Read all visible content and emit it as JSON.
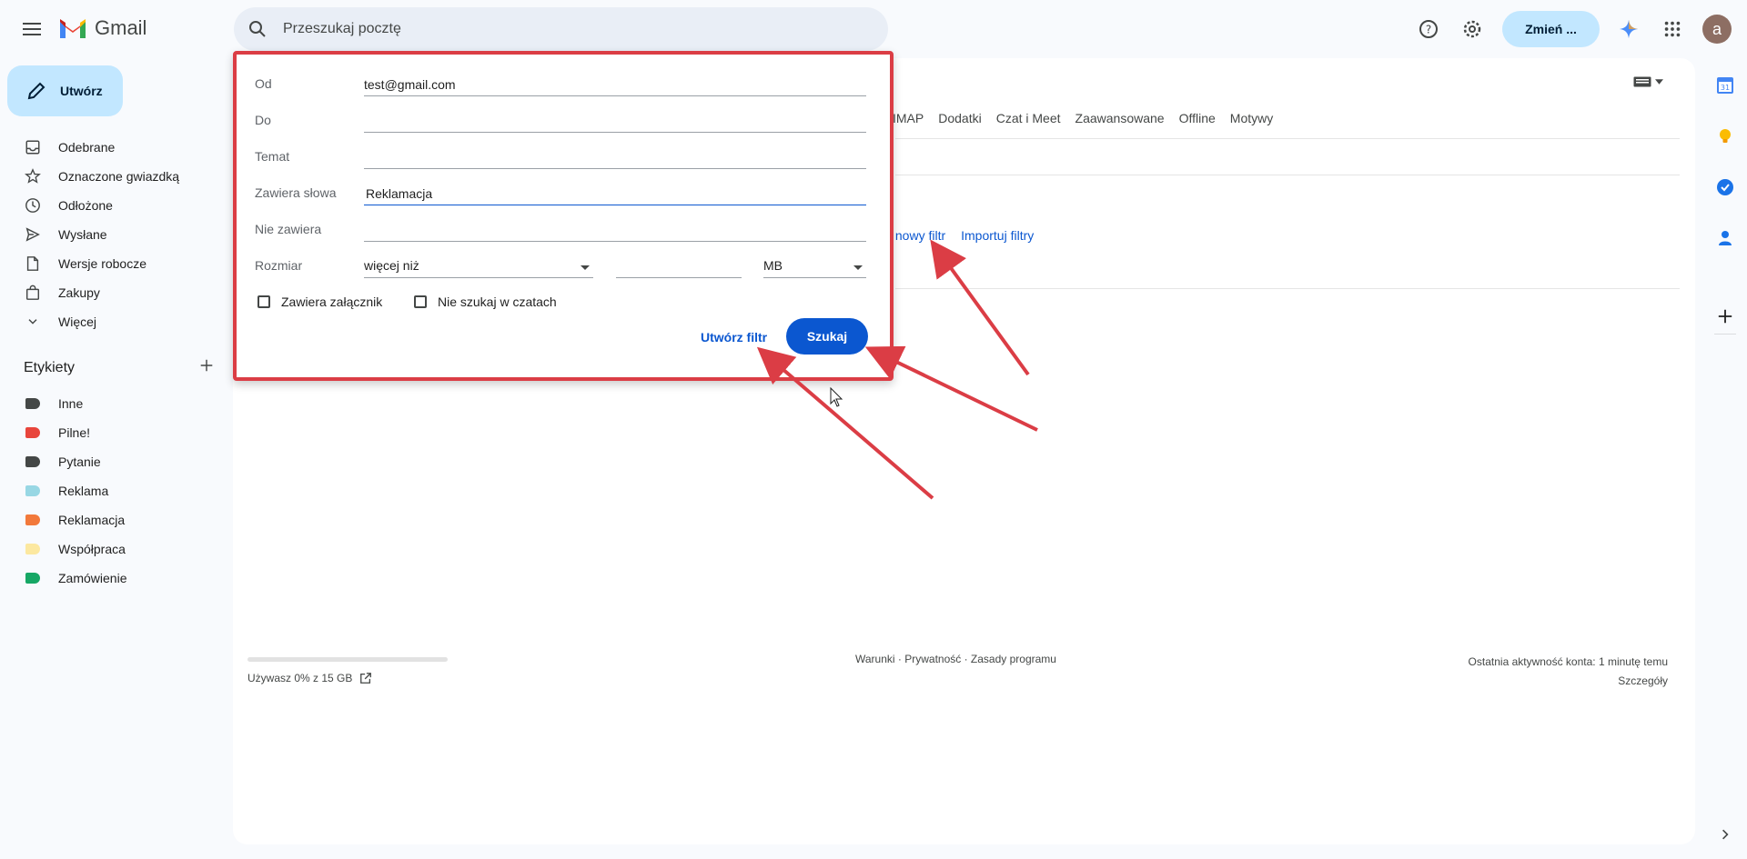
{
  "app": {
    "name": "Gmail"
  },
  "search": {
    "placeholder": "Przeszukaj pocztę"
  },
  "header": {
    "switch_button": "Zmień ...",
    "avatar_letter": "a"
  },
  "compose": {
    "label": "Utwórz"
  },
  "nav": {
    "items": [
      {
        "label": "Odebrane",
        "icon": "inbox-icon"
      },
      {
        "label": "Oznaczone gwiazdką",
        "icon": "star-icon"
      },
      {
        "label": "Odłożone",
        "icon": "clock-icon"
      },
      {
        "label": "Wysłane",
        "icon": "send-icon"
      },
      {
        "label": "Wersje robocze",
        "icon": "draft-icon"
      },
      {
        "label": "Zakupy",
        "icon": "shopping-bag-icon"
      },
      {
        "label": "Więcej",
        "icon": "chevron-down-icon"
      }
    ]
  },
  "labels": {
    "title": "Etykiety",
    "items": [
      {
        "label": "Inne",
        "color": "#444746"
      },
      {
        "label": "Pilne!",
        "color": "#e8453c"
      },
      {
        "label": "Pytanie",
        "color": "#444746"
      },
      {
        "label": "Reklama",
        "color": "#98d7e4"
      },
      {
        "label": "Reklamacja",
        "color": "#f2793b"
      },
      {
        "label": "Współpraca",
        "color": "#fce8a0"
      },
      {
        "label": "Zamówienie",
        "color": "#16a765"
      }
    ]
  },
  "settings_tabs": [
    "IMAP",
    "Dodatki",
    "Czat i Meet",
    "Zaawansowane",
    "Offline",
    "Motywy"
  ],
  "filter_links": {
    "create": "z nowy filtr",
    "import": "Importuj filtry"
  },
  "search_popup": {
    "from": {
      "label": "Od",
      "value": "test@gmail.com"
    },
    "to": {
      "label": "Do",
      "value": ""
    },
    "subject": {
      "label": "Temat",
      "value": ""
    },
    "has_words": {
      "label": "Zawiera słowa",
      "value": "Reklamacja"
    },
    "doesnt_have": {
      "label": "Nie zawiera",
      "value": ""
    },
    "size": {
      "label": "Rozmiar",
      "operator": "więcej niż",
      "value": "",
      "unit": "MB"
    },
    "has_attachment": "Zawiera załącznik",
    "exclude_chats": "Nie szukaj w czatach",
    "create_filter": "Utwórz filtr",
    "search_button": "Szukaj"
  },
  "footer": {
    "storage": "Używasz 0% z 15 GB",
    "storage_fraction": 0.0,
    "links": "Warunki · Prywatność · Zasady programu",
    "activity": "Ostatnia aktywność konta: 1 minutę temu",
    "details": "Szczegóły"
  },
  "calendar_day": "31",
  "colors": {
    "accent": "#0b57d0",
    "annotation": "#db3d45",
    "compose_bg": "#c2e7ff"
  }
}
